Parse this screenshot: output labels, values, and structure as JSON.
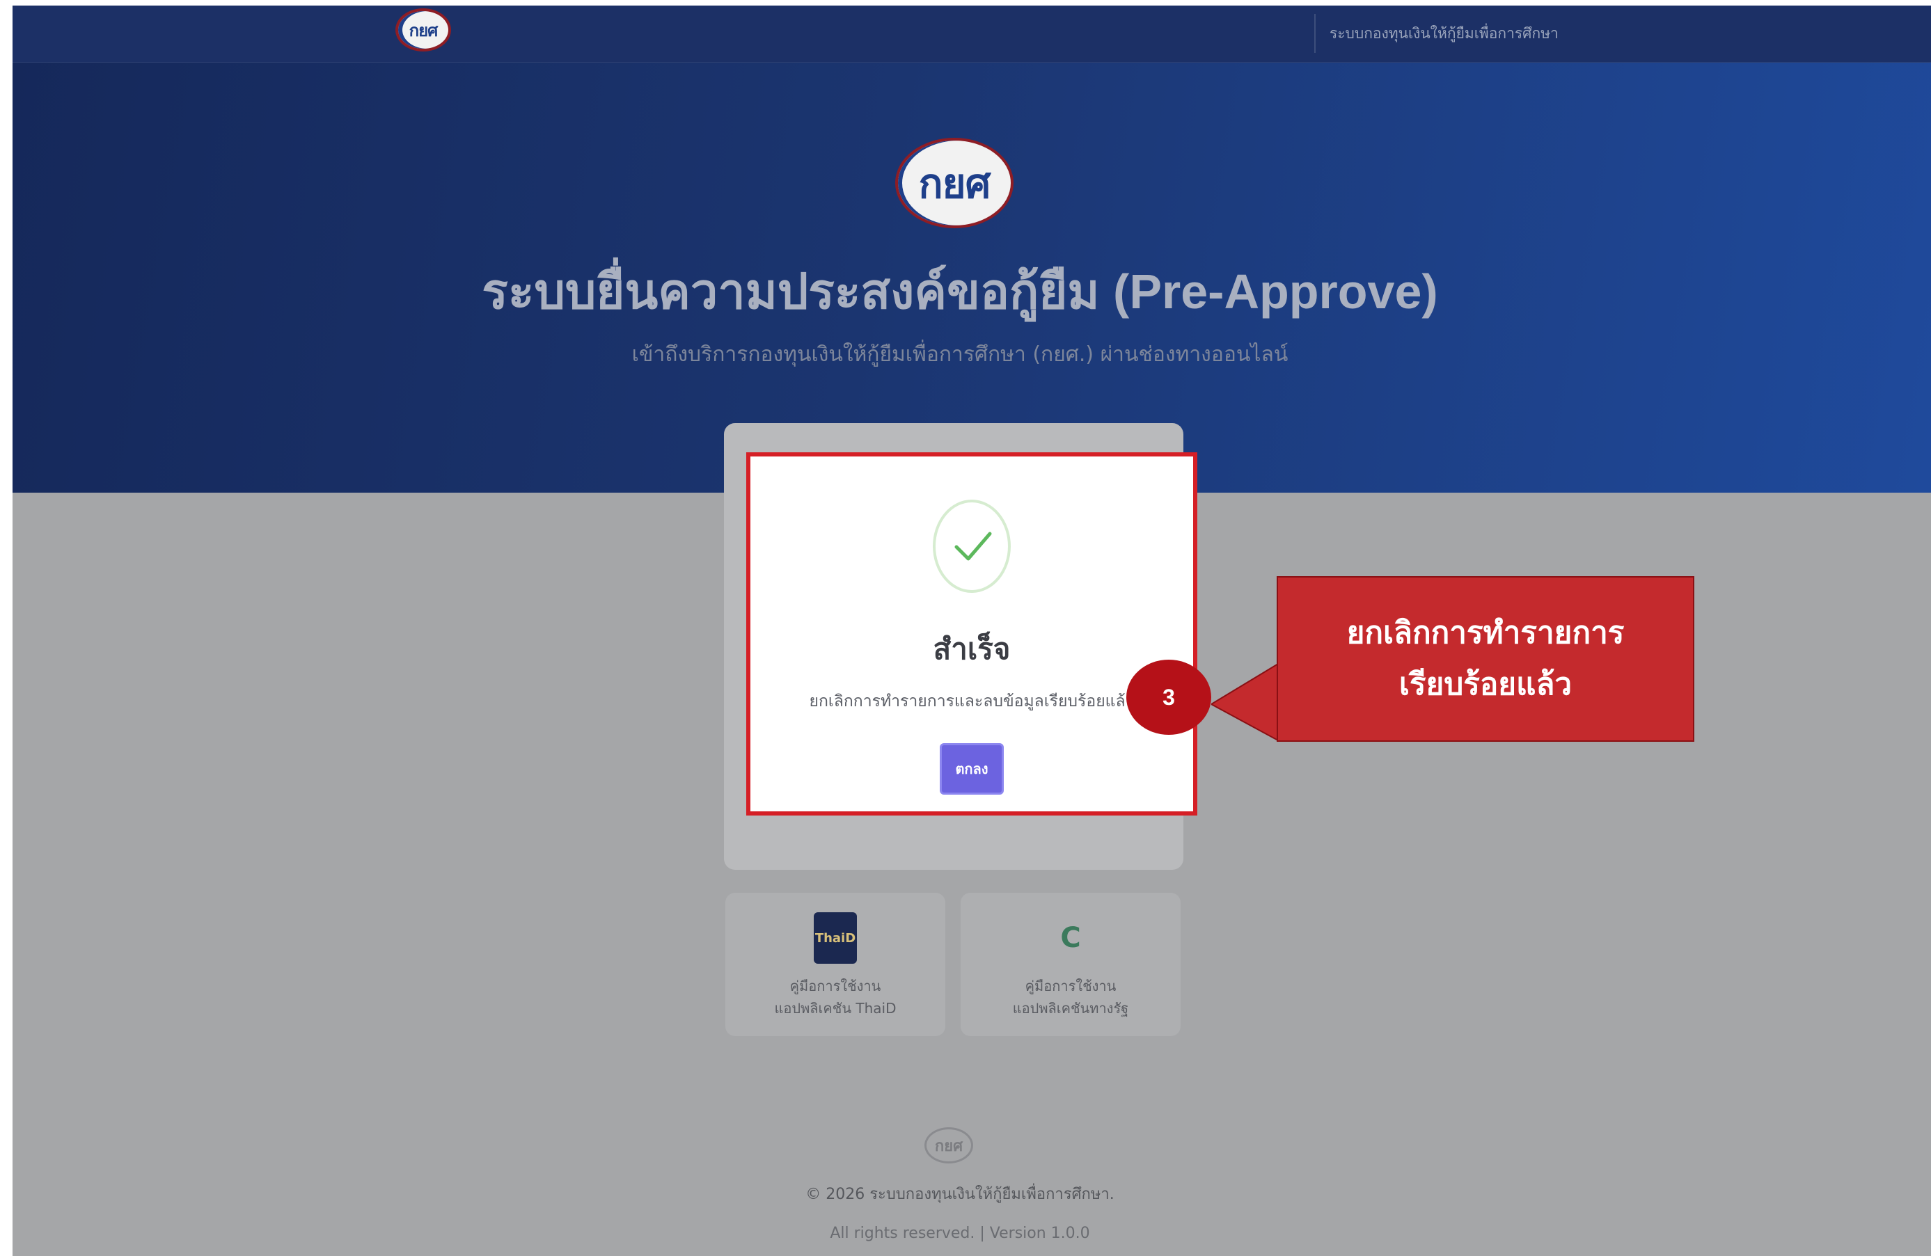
{
  "header": {
    "logo_text": "กยศ",
    "system_name": "ระบบกองทุนเงินให้กู้ยืมเพื่อการศึกษา"
  },
  "hero": {
    "logo_text": "กยศ",
    "title": "ระบบยื่นความประสงค์ขอกู้ยืม (Pre-Approve)",
    "subtitle": "เข้าถึงบริการกองทุนเงินให้กู้ยืมเพื่อการศึกษา (กยศ.) ผ่านช่องทางออนไลน์"
  },
  "dialog": {
    "icon": "check-circle-icon",
    "title": "สำเร็จ",
    "message": "ยกเลิกการทำรายการและลบข้อมูลเรียบร้อยแล้ว",
    "ok_label": "ตกลง"
  },
  "app_cards": [
    {
      "icon": "thaid-app-icon",
      "icon_text": "ThaiD",
      "line1": "คู่มือการใช้งาน",
      "line2": "แอปพลิเคชัน ThaiD"
    },
    {
      "icon": "tangrat-app-icon",
      "icon_text": "C",
      "line1": "คู่มือการใช้งาน",
      "line2": "แอปพลิเคชันทางรัฐ"
    }
  ],
  "footer": {
    "logo_text": "กยศ",
    "copyright": "© 2026 ระบบกองทุนเงินให้กู้ยืมเพื่อการศึกษา.",
    "rights": "All rights reserved.  |  Version 1.0.0"
  },
  "annotation": {
    "step_number": "3",
    "callout_line1": "ยกเลิกการทำรายการ",
    "callout_line2": "เรียบร้อยแล้ว"
  },
  "colors": {
    "hero_dark": "#15285a",
    "hero_light": "#1f4a9c",
    "overlay_gray": "#a5a6a8",
    "primary_button": "#6c63e0",
    "success_green": "#5cb85c",
    "annotation_red": "#c42a2d"
  }
}
